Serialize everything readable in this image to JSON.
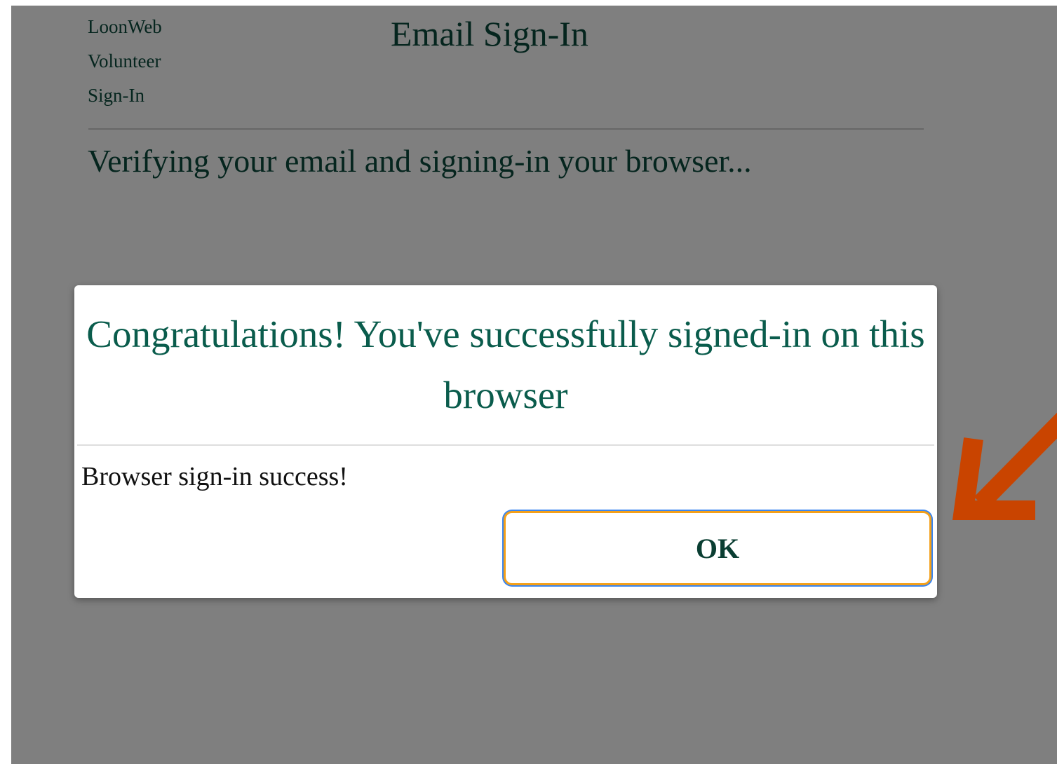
{
  "header": {
    "brand_lines": [
      "LoonWeb",
      "Volunteer",
      "Sign-In"
    ],
    "page_title": "Email Sign-In"
  },
  "main": {
    "status_text": "Verifying your email and signing-in your browser..."
  },
  "dialog": {
    "title": "Congratulations! You've successfully signed-in on this browser",
    "message": "Browser sign-in success!",
    "ok_label": "OK"
  },
  "annotation": {
    "arrow_color": "#c94400",
    "icon": "arrow-pointer-icon"
  },
  "colors": {
    "brand_green": "#0a4a3c",
    "dialog_title_green": "#0a5c4c",
    "focus_outline_orange": "#f4a019",
    "focus_ring_blue": "#3b86f0"
  }
}
